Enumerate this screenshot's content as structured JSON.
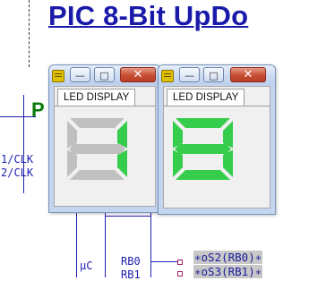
{
  "schematic": {
    "title": "PIC  8-Bit UpDo",
    "p_label": "P",
    "pin_clk1": "1/CLK",
    "pin_clk2": "2/CLK",
    "uc_label": "μC",
    "rb0_label": "RB0",
    "rb1_label": "RB1",
    "net_tag_1": "∗oS2(RB0)∗",
    "net_tag_2": "∗oS3(RB1)∗"
  },
  "windows": [
    {
      "tab_label": "LED DISPLAY",
      "digit": "1",
      "minimize_glyph": "—",
      "maximize_glyph": "□",
      "close_glyph": "✕",
      "icon": "app-menu-icon"
    },
    {
      "tab_label": "LED DISPLAY",
      "digit": "8",
      "minimize_glyph": "—",
      "maximize_glyph": "□",
      "close_glyph": "✕",
      "icon": "app-menu-icon"
    }
  ],
  "colors": {
    "segment_on": "#35cd4b",
    "segment_off": "#c0c0c0",
    "schematic_blue": "#2020b0",
    "title_blue": "#1a1aaa"
  }
}
